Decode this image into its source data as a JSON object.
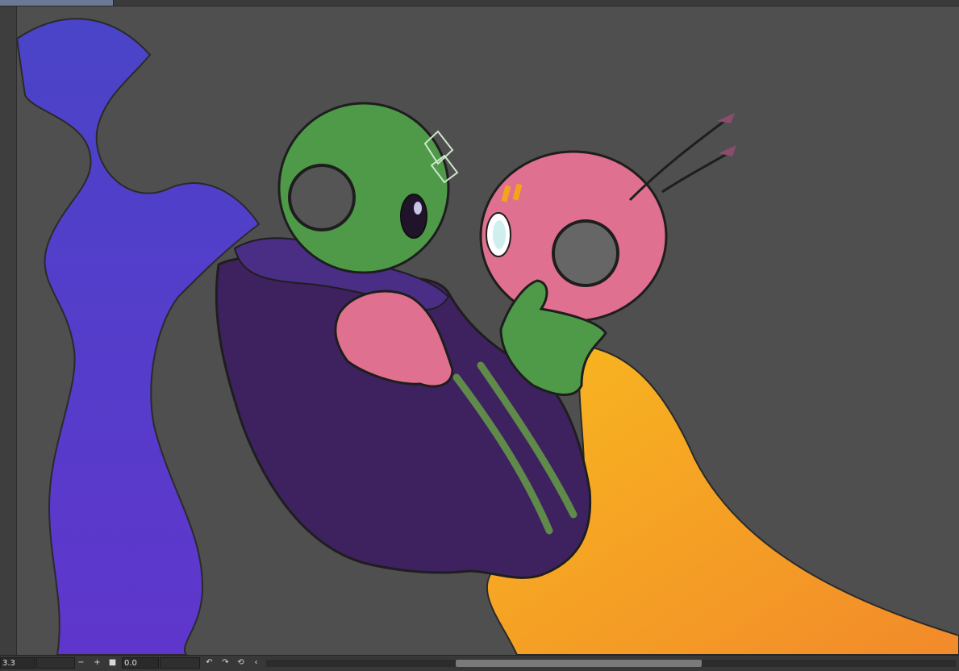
{
  "canvas": {
    "background": "#4f4f4f",
    "artwork": "two-aliens-embrace-sketch"
  },
  "statusbar": {
    "zoom_value": "3.3",
    "rotation_value": "0.0",
    "zoom_out_icon": "minus-icon",
    "zoom_in_icon": "plus-icon",
    "fit_icon": "square-icon",
    "rotate_left_icon": "rotate-left-icon",
    "rotate_right_icon": "rotate-right-icon",
    "reset_rotation_icon": "reset-rotation-icon",
    "flip_icon": "chevron-left-icon"
  },
  "colors": {
    "purple_cape": "#5434c4",
    "dark_robe": "#3e2260",
    "green_alien": "#4e9a48",
    "pink_alien": "#e0708f",
    "yellow_robe": "#f4a91e",
    "stripe_green": "#5f8a4a"
  }
}
